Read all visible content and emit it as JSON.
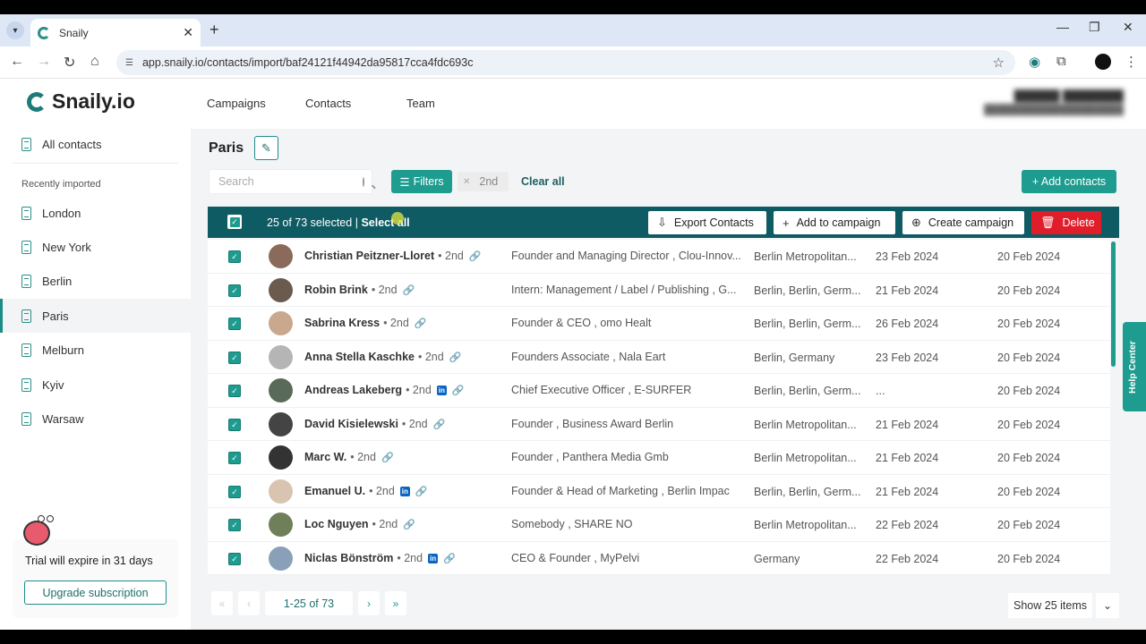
{
  "browser": {
    "tab_title": "Snaily",
    "url": "app.snaily.io/contacts/import/baf24121f44942da95817cca4fdc693c"
  },
  "app": {
    "logo_text": "Snaily.io",
    "accent_color": "#1e9c8f",
    "nav": {
      "campaigns": "Campaigns",
      "contacts": "Contacts",
      "team": "Team"
    }
  },
  "sidebar": {
    "all_contacts": "All contacts",
    "recent_heading": "Recently imported",
    "items": [
      "London",
      "New York",
      "Berlin",
      "Paris",
      "Melburn",
      "Kyiv",
      "Warsaw"
    ],
    "active": "Paris",
    "trial_text": "Trial will expire in 31 days",
    "upgrade_label": "Upgrade subscription"
  },
  "page": {
    "title": "Paris",
    "search_placeholder": "Search",
    "filters_label": "Filters",
    "chip_label": "2nd",
    "clear_label": "Clear all",
    "add_contacts_label": "+ Add contacts"
  },
  "selection": {
    "count_text": "25 of 73 selected",
    "separator": "|",
    "select_all_label": "Select all",
    "export_label": "Export Contacts",
    "add_campaign_label": "Add to campaign",
    "create_campaign_label": "Create campaign",
    "delete_label": "Delete"
  },
  "contacts": [
    {
      "name": "Christian Peitzner-Lloret",
      "degree": "• 2nd",
      "linkedin": false,
      "title": "Founder and Managing Director , Clou-Innov...",
      "location": "Berlin Metropolitan...",
      "date1": "23 Feb 2024",
      "date2": "20 Feb 2024"
    },
    {
      "name": "Robin Brink",
      "degree": "• 2nd",
      "linkedin": false,
      "title": "Intern: Management / Label / Publishing , G...",
      "location": "Berlin, Berlin, Germ...",
      "date1": "21 Feb 2024",
      "date2": "20 Feb 2024"
    },
    {
      "name": "Sabrina Kress",
      "degree": "• 2nd",
      "linkedin": false,
      "title": "Founder & CEO , omo Healt",
      "location": "Berlin, Berlin, Germ...",
      "date1": "26 Feb 2024",
      "date2": "20 Feb 2024"
    },
    {
      "name": "Anna Stella Kaschke",
      "degree": "• 2nd",
      "linkedin": false,
      "title": "Founders Associate , Nala Eart",
      "location": "Berlin, Germany",
      "date1": "23 Feb 2024",
      "date2": "20 Feb 2024"
    },
    {
      "name": "Andreas Lakeberg",
      "degree": "• 2nd",
      "linkedin": true,
      "title": "Chief Executive Officer , E-SURFER",
      "location": "Berlin, Berlin, Germ...",
      "date1": "...",
      "date2": "20 Feb 2024"
    },
    {
      "name": "David Kisielewski",
      "degree": "• 2nd",
      "linkedin": false,
      "title": "Founder , Business Award Berlin",
      "location": "Berlin Metropolitan...",
      "date1": "21 Feb 2024",
      "date2": "20 Feb 2024"
    },
    {
      "name": "Marc W.",
      "degree": "• 2nd",
      "linkedin": false,
      "title": "Founder , Panthera Media Gmb",
      "location": "Berlin Metropolitan...",
      "date1": "21 Feb 2024",
      "date2": "20 Feb 2024"
    },
    {
      "name": "Emanuel U.",
      "degree": "• 2nd",
      "linkedin": true,
      "title": "Founder & Head of Marketing , Berlin Impac",
      "location": "Berlin, Berlin, Germ...",
      "date1": "21 Feb 2024",
      "date2": "20 Feb 2024"
    },
    {
      "name": "Loc Nguyen",
      "degree": "• 2nd",
      "linkedin": false,
      "title": "Somebody , SHARE NO",
      "location": "Berlin Metropolitan...",
      "date1": "22 Feb 2024",
      "date2": "20 Feb 2024"
    },
    {
      "name": "Niclas Bönström",
      "degree": "• 2nd",
      "linkedin": true,
      "title": "CEO & Founder , MyPelvi",
      "location": "Germany",
      "date1": "22 Feb 2024",
      "date2": "20 Feb 2024"
    }
  ],
  "pagination": {
    "range_text": "1-25 of 73",
    "show_items_label": "Show 25 items"
  },
  "help_label": "Help Center"
}
